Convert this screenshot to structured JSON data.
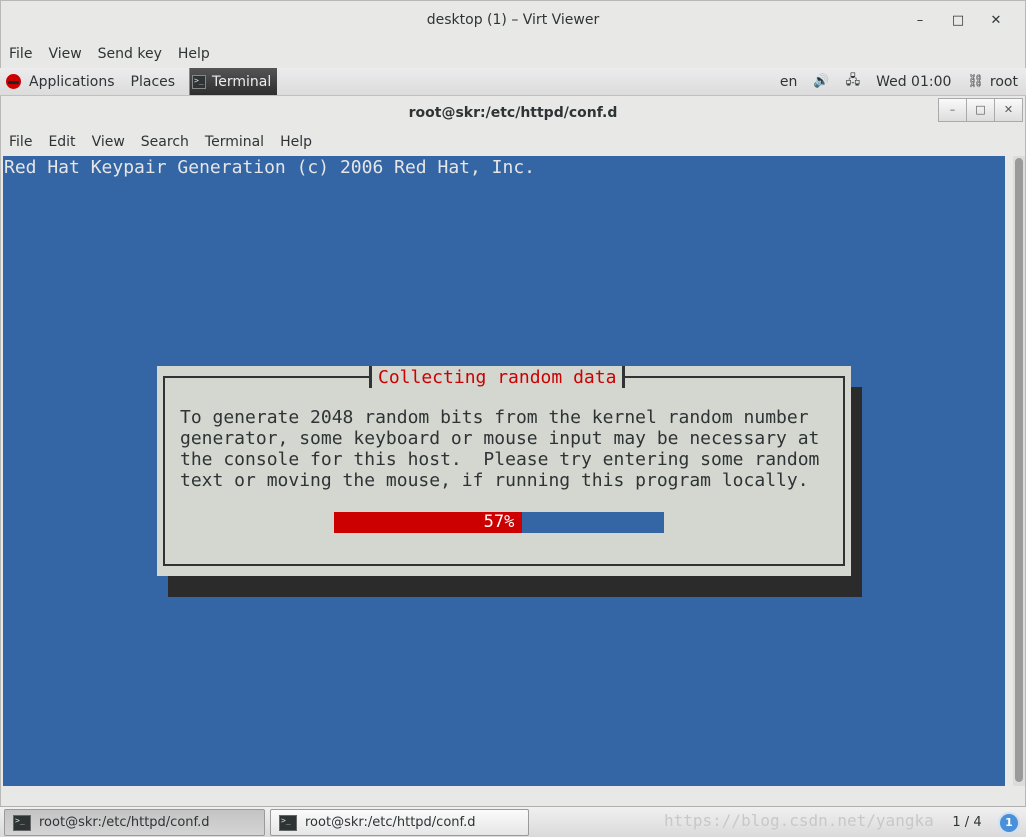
{
  "virt_viewer": {
    "title": "desktop (1) – Virt Viewer",
    "controls": {
      "minimize": "–",
      "maximize": "□",
      "close": "✕"
    },
    "menu": [
      "File",
      "View",
      "Send key",
      "Help"
    ]
  },
  "top_panel": {
    "applications": "Applications",
    "places": "Places",
    "task": "Terminal",
    "language": "en",
    "clock": "Wed 01:00",
    "user": "root",
    "icons": [
      "volume-icon",
      "network-icon",
      "user-icon"
    ]
  },
  "terminal": {
    "title": "root@skr:/etc/httpd/conf.d",
    "controls": {
      "minimize": "–",
      "maximize": "□",
      "close": "✕"
    },
    "menu": [
      "File",
      "Edit",
      "View",
      "Search",
      "Terminal",
      "Help"
    ],
    "header_line": "Red Hat Keypair Generation (c) 2006 Red Hat, Inc.",
    "screen_bg": "#3465a4"
  },
  "dialog": {
    "title": "Collecting random data",
    "body": [
      "To generate 2048 random bits from the kernel random number",
      "generator, some keyboard or mouse input may be necessary at",
      "the console for this host.  Please try entering some random",
      "text or moving the mouse, if running this program locally."
    ],
    "progress_label": "57%",
    "progress_fraction": 0.57,
    "colors": {
      "title": "#cc0000",
      "fill": "#cc0000",
      "track": "#3465a4",
      "bg": "#d3d7cf"
    }
  },
  "taskbar": {
    "tasks": [
      {
        "label": "root@skr:/etc/httpd/conf.d"
      },
      {
        "label": "root@skr:/etc/httpd/conf.d"
      }
    ],
    "watermark": "https://blog.csdn.net/yangka",
    "workspace": "1 / 4",
    "notification_count": "1"
  }
}
